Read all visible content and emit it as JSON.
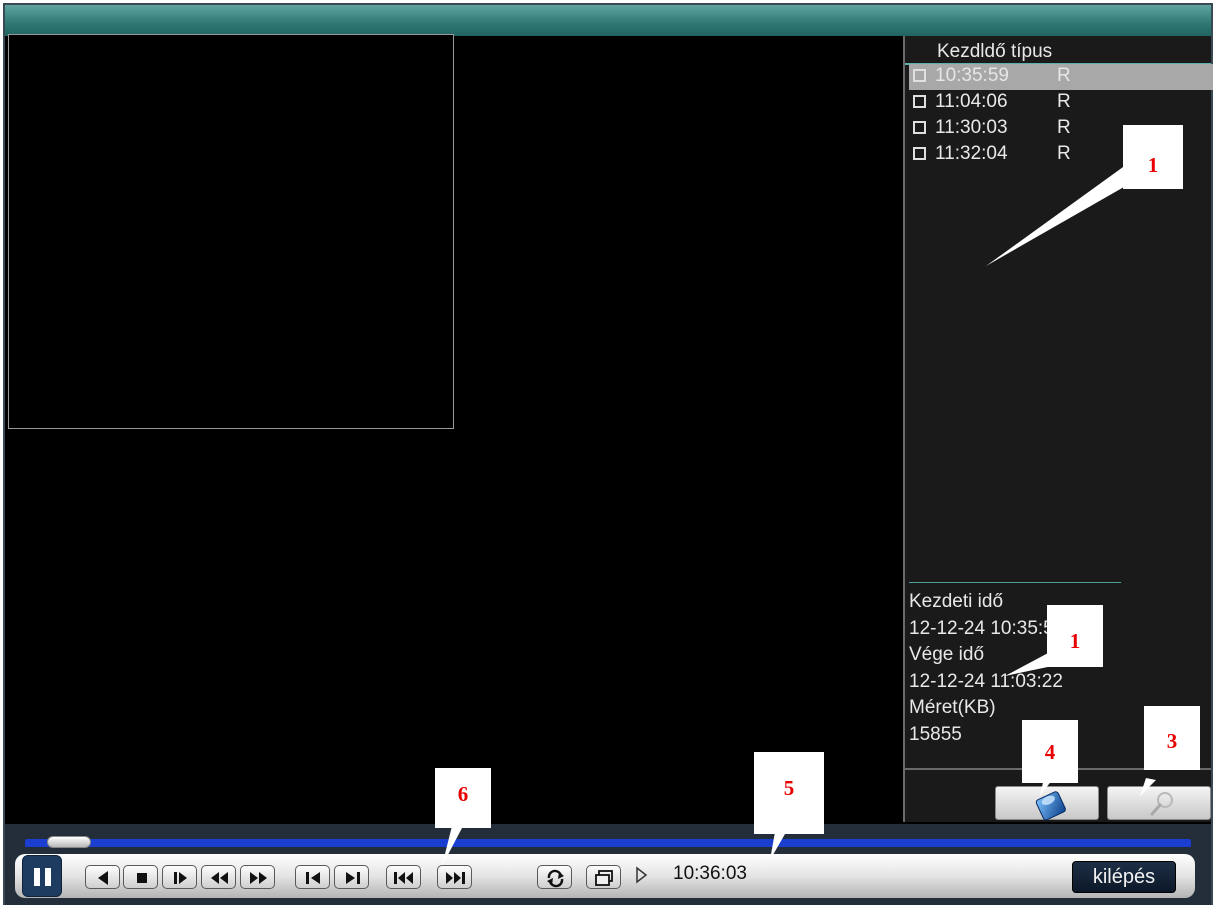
{
  "file_list": {
    "header": "Kezdldő típus",
    "items": [
      {
        "time": "10:35:59",
        "type": "R",
        "selected": true
      },
      {
        "time": "11:04:06",
        "type": "R",
        "selected": false
      },
      {
        "time": "11:30:03",
        "type": "R",
        "selected": false
      },
      {
        "time": "11:32:04",
        "type": "R",
        "selected": false
      }
    ]
  },
  "file_info": {
    "start_label": "Kezdeti idő",
    "start_value": "12-12-24 10:35:59",
    "end_label": "Vége idő",
    "end_value": "12-12-24 11:03:22",
    "size_label": "Méret(KB)",
    "size_value": "15855"
  },
  "tool_buttons": {
    "backup_icon": "disk-icon",
    "search_icon": "magnifier-icon"
  },
  "playback": {
    "progress": 0.02,
    "current_time": "10:36:03",
    "exit_label": "kilépés",
    "controls": [
      "pause-icon",
      "play-reverse-icon",
      "stop-icon",
      "step-forward-icon",
      "rewind-icon",
      "fast-forward-icon",
      "prev-frame-icon",
      "next-frame-icon",
      "prev-file-icon",
      "next-file-icon",
      "loop-icon",
      "fullscreen-icon"
    ]
  },
  "annotations": {
    "label_1a": "1",
    "label_1b": "1",
    "label_3": "3",
    "label_4": "4",
    "label_5": "5",
    "label_6": "6"
  },
  "colors": {
    "title_bar": "#2f7774",
    "progress": "#1a3fd0",
    "selected_row": "#a8a8a8",
    "annotation_text": "#e80000"
  }
}
